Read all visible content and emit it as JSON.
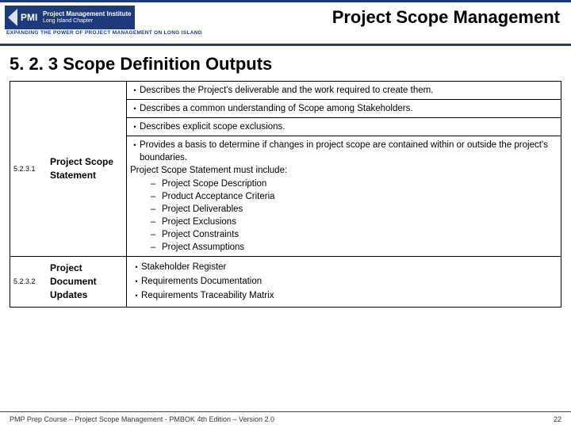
{
  "header": {
    "logo_line1": "Project Management Institute",
    "logo_line2": "Long Island Chapter",
    "tagline": "EXPANDING THE POWER OF PROJECT MANAGEMENT ON LONG ISLAND",
    "title": "Project Scope Management"
  },
  "section": {
    "heading": "5. 2. 3 Scope Definition Outputs"
  },
  "rows": [
    {
      "num": "5.2.3.1",
      "name": "Project Scope Statement",
      "bullets": [
        "Describes the Project's deliverable and the work required to create them.",
        "Describes a common understanding of Scope among Stakeholders.",
        "Describes explicit scope exclusions."
      ],
      "last_bullet_lead": "Provides a basis to determine if changes in project scope are contained within or outside the project's boundaries.",
      "last_bullet_intro": "Project Scope Statement must include:",
      "sub_items": [
        "Project Scope Description",
        "Product Acceptance Criteria",
        "Project Deliverables",
        "Project Exclusions",
        "Project Constraints",
        "Project Assumptions"
      ]
    },
    {
      "num": "5.2.3.2",
      "name": "Project Document Updates",
      "bullets": [
        "Stakeholder Register",
        "Requirements Documentation",
        "Requirements Traceability Matrix"
      ]
    }
  ],
  "footer": {
    "left": "PMP Prep Course – Project Scope Management - PMBOK 4th Edition – Version 2.0",
    "right": "22"
  }
}
